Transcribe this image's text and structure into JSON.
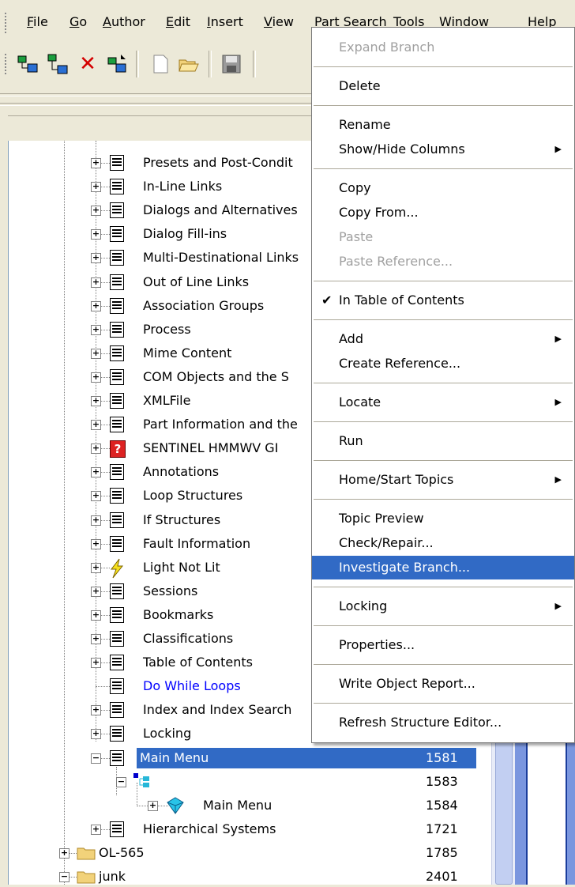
{
  "menubar": {
    "items": [
      {
        "label": "File",
        "key": "F",
        "rest": "ile"
      },
      {
        "label": "Go",
        "key": "G",
        "rest": "o"
      },
      {
        "label": "Author",
        "key": "A",
        "rest": "uthor"
      },
      {
        "label": "Edit",
        "key": "E",
        "rest": "dit"
      },
      {
        "label": "Insert",
        "key": "I",
        "rest": "nsert"
      },
      {
        "label": "View",
        "key": "V",
        "rest": "iew"
      },
      {
        "label": "Part Search",
        "key": "P",
        "rest": "art Search"
      },
      {
        "label": "Tools",
        "key": "T",
        "rest": "ools"
      },
      {
        "label": "Window",
        "key": "W",
        "rest": "indow"
      },
      {
        "label": "Help",
        "key": "H",
        "rest": "elp"
      }
    ]
  },
  "toolbar": {
    "buttons": [
      "add-child-icon",
      "add-sibling-icon",
      "delete-icon",
      "move-icon",
      "new-icon",
      "open-icon",
      "save-icon"
    ],
    "delete_glyph": "✕"
  },
  "tree": {
    "rows": [
      {
        "label": "Presets and Post-Condit",
        "icon": "doc"
      },
      {
        "label": "In-Line Links",
        "icon": "doc"
      },
      {
        "label": "Dialogs and Alternatives",
        "icon": "doc"
      },
      {
        "label": "Dialog Fill-ins",
        "icon": "doc"
      },
      {
        "label": "Multi-Destinational Links",
        "icon": "doc"
      },
      {
        "label": "Out of Line Links",
        "icon": "doc"
      },
      {
        "label": "Association Groups",
        "icon": "doc"
      },
      {
        "label": "Process",
        "icon": "doc"
      },
      {
        "label": "Mime Content",
        "icon": "doc"
      },
      {
        "label": "COM Objects and the S",
        "icon": "doc"
      },
      {
        "label": "XMLFile",
        "icon": "doc"
      },
      {
        "label": "Part Information and the",
        "icon": "doc"
      },
      {
        "label": "SENTINEL HMMWV GI",
        "icon": "question"
      },
      {
        "label": "Annotations",
        "icon": "doc"
      },
      {
        "label": "Loop Structures",
        "icon": "doc"
      },
      {
        "label": "If Structures",
        "icon": "doc"
      },
      {
        "label": "Fault Information",
        "icon": "doc"
      },
      {
        "label": "Light Not Lit",
        "icon": "bolt"
      },
      {
        "label": "Sessions",
        "icon": "doc"
      },
      {
        "label": "Bookmarks",
        "icon": "doc"
      },
      {
        "label": "Classifications",
        "icon": "doc"
      },
      {
        "label": "Table of Contents",
        "icon": "doc"
      },
      {
        "label": "Do While Loops",
        "icon": "doc",
        "color": "#0000ff",
        "noexpand": true
      },
      {
        "label": "Index and Index Search",
        "icon": "doc"
      },
      {
        "label": "Locking",
        "icon": "doc"
      }
    ],
    "main_menu": {
      "label": "Main Menu",
      "num": "1581"
    },
    "sub_node": {
      "label": "",
      "num": "1583"
    },
    "sub_main_menu": {
      "label": "Main Menu",
      "num": "1584"
    },
    "hierarchical": {
      "label": "Hierarchical Systems",
      "num": "1721"
    },
    "ol565": {
      "label": "OL-565",
      "num": "1785"
    },
    "junk": {
      "label": "junk",
      "num": "2401"
    }
  },
  "context_menu": {
    "items": [
      {
        "label": "Expand Branch",
        "disabled": true
      },
      {
        "sep": true
      },
      {
        "label": "Delete"
      },
      {
        "sep": true
      },
      {
        "label": "Rename"
      },
      {
        "label": "Show/Hide Columns",
        "submenu": true
      },
      {
        "sep": true
      },
      {
        "label": "Copy"
      },
      {
        "label": "Copy From..."
      },
      {
        "label": "Paste",
        "disabled": true
      },
      {
        "label": "Paste Reference...",
        "disabled": true
      },
      {
        "sep": true
      },
      {
        "label": "In Table of Contents",
        "checked": true
      },
      {
        "sep": true
      },
      {
        "label": "Add",
        "submenu": true
      },
      {
        "label": "Create Reference..."
      },
      {
        "sep": true
      },
      {
        "label": "Locate",
        "submenu": true
      },
      {
        "sep": true
      },
      {
        "label": "Run"
      },
      {
        "sep": true
      },
      {
        "label": "Home/Start Topics",
        "submenu": true
      },
      {
        "sep": true
      },
      {
        "label": "Topic Preview"
      },
      {
        "label": "Check/Repair..."
      },
      {
        "label": "Investigate Branch...",
        "highlighted": true
      },
      {
        "sep": true
      },
      {
        "label": "Locking",
        "submenu": true
      },
      {
        "sep": true
      },
      {
        "label": "Properties..."
      },
      {
        "sep": true
      },
      {
        "label": "Write Object Report..."
      },
      {
        "sep": true
      },
      {
        "label": "Refresh Structure Editor..."
      }
    ],
    "submenu_arrow": "▶",
    "check_glyph": "✔"
  },
  "colors": {
    "selection": "#316ac5",
    "link": "#0000ff",
    "folder": "#f2d27a"
  }
}
